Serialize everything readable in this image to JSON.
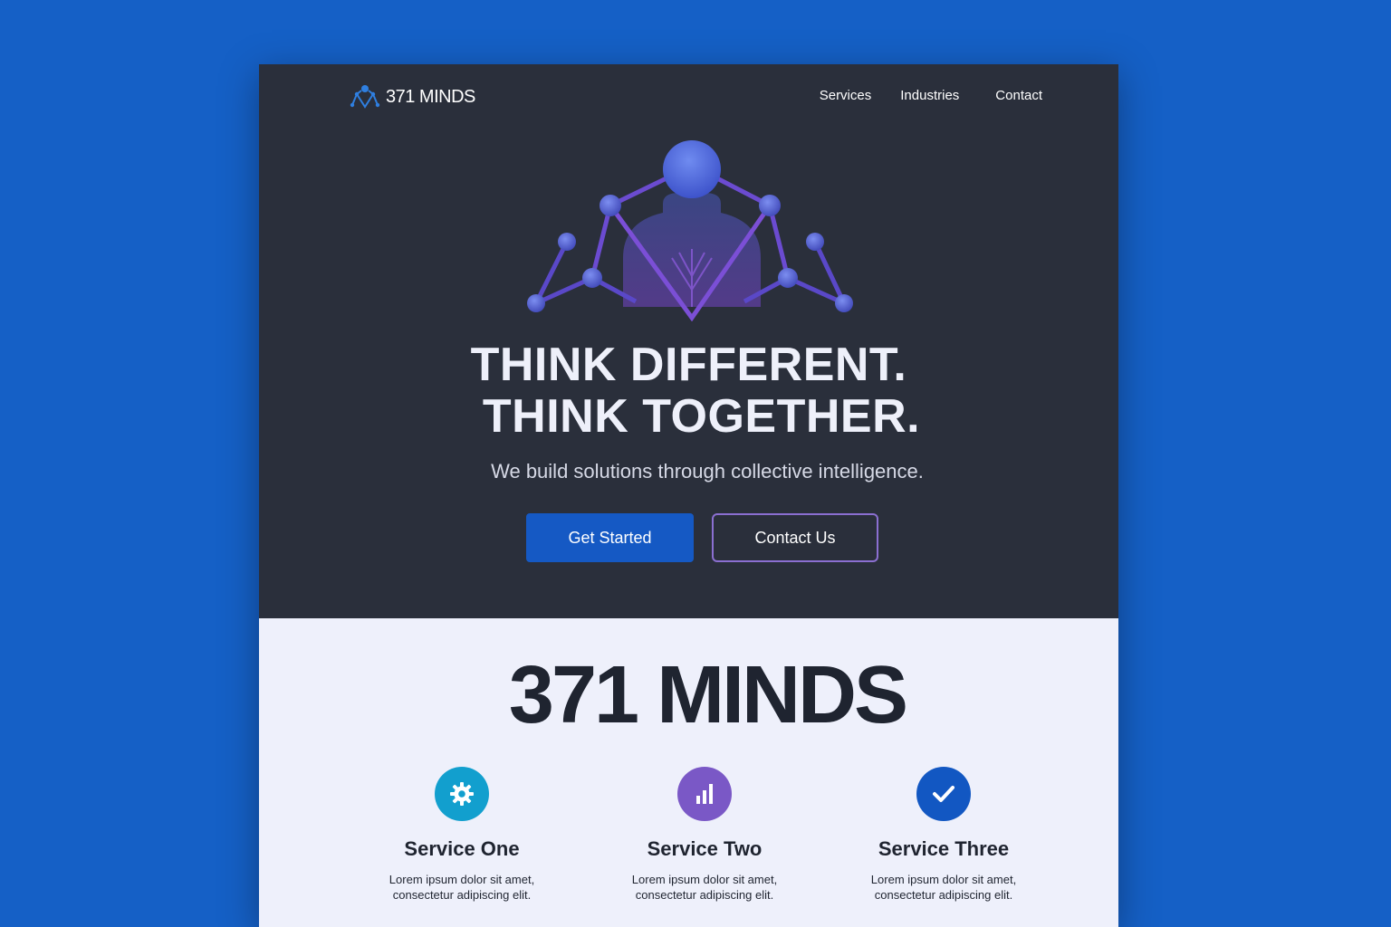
{
  "colors": {
    "background": "#1560c6",
    "hero": "#2a2f3b",
    "primary_button": "#1559c4",
    "secondary_border": "#8b6fd1",
    "lower_bg": "#eef0fb",
    "service_one": "#129fce",
    "service_two": "#7a58c6",
    "service_three": "#1257c2"
  },
  "nav": {
    "brand": "371 MINDS",
    "logo_icon": "network-person-logo-icon",
    "links": [
      "Services",
      "Industries",
      "Contact"
    ]
  },
  "hero": {
    "emblem_icon": "network-mind-emblem-icon",
    "headline_line1": "THINK DIFFERENT.",
    "headline_line2": "THINK TOGETHER.",
    "tagline": "We build solutions through collective intelligence.",
    "primary_cta": "Get Started",
    "secondary_cta": "Contact Us"
  },
  "section": {
    "title": "371 MINDS",
    "services": [
      {
        "icon": "gear-icon",
        "title": "Service One",
        "desc_line1": "Lorem ipsum dolor sit amet,",
        "desc_line2": "consectetur adipiscing elit."
      },
      {
        "icon": "bar-chart-icon",
        "title": "Service Two",
        "desc_line1": "Lorem ipsum dolor sit amet,",
        "desc_line2": "consectetur adipiscing elit."
      },
      {
        "icon": "checkmark-icon",
        "title": "Service Three",
        "desc_line1": "Lorem ipsum dolor sit amet,",
        "desc_line2": "consectetur adipiscing elit."
      }
    ]
  }
}
